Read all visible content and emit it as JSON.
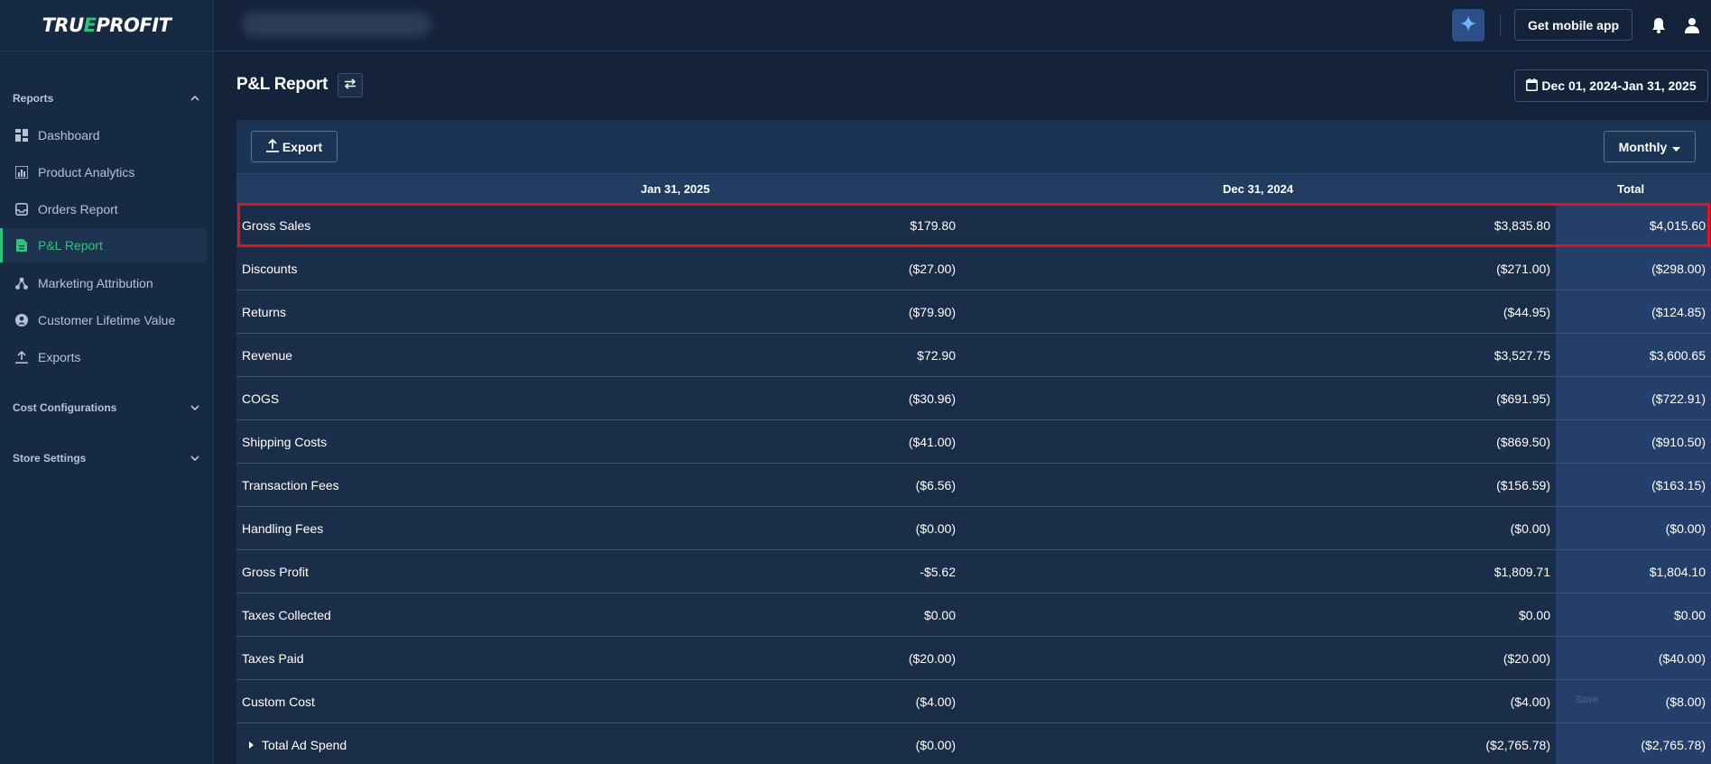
{
  "app": {
    "logo_pre": "TRU",
    "logo_mark": "E",
    "logo_post": "PROFIT"
  },
  "sidebar": {
    "reports_label": "Reports",
    "items": [
      {
        "label": "Dashboard",
        "icon": "dashboard-icon"
      },
      {
        "label": "Product Analytics",
        "icon": "bar-chart-icon"
      },
      {
        "label": "Orders Report",
        "icon": "inbox-icon"
      },
      {
        "label": "P&L Report",
        "icon": "document-icon",
        "active": true
      },
      {
        "label": "Marketing Attribution",
        "icon": "network-icon"
      },
      {
        "label": "Customer Lifetime Value",
        "icon": "user-circle-icon"
      },
      {
        "label": "Exports",
        "icon": "upload-icon"
      }
    ],
    "cost_config_label": "Cost Configurations",
    "store_settings_label": "Store Settings"
  },
  "topbar": {
    "mobile_label": "Get mobile app"
  },
  "page": {
    "title": "P&L Report",
    "date_range": "Dec 01, 2024-Jan 31, 2025"
  },
  "toolbar": {
    "export_label": "Export",
    "period_label": "Monthly"
  },
  "table": {
    "headers": [
      "Jan 31, 2025",
      "Dec 31, 2024",
      "Total"
    ],
    "rows": [
      {
        "label": "Gross Sales",
        "c1": "$179.80",
        "c2": "$3,835.80",
        "total": "$4,015.60"
      },
      {
        "label": "Discounts",
        "c1": "($27.00)",
        "c2": "($271.00)",
        "total": "($298.00)"
      },
      {
        "label": "Returns",
        "c1": "($79.90)",
        "c2": "($44.95)",
        "total": "($124.85)"
      },
      {
        "label": "Revenue",
        "c1": "$72.90",
        "c2": "$3,527.75",
        "total": "$3,600.65"
      },
      {
        "label": "COGS",
        "c1": "($30.96)",
        "c2": "($691.95)",
        "total": "($722.91)"
      },
      {
        "label": "Shipping Costs",
        "c1": "($41.00)",
        "c2": "($869.50)",
        "total": "($910.50)"
      },
      {
        "label": "Transaction Fees",
        "c1": "($6.56)",
        "c2": "($156.59)",
        "total": "($163.15)"
      },
      {
        "label": "Handling Fees",
        "c1": "($0.00)",
        "c2": "($0.00)",
        "total": "($0.00)"
      },
      {
        "label": "Gross Profit",
        "c1": "-$5.62",
        "c2": "$1,809.71",
        "total": "$1,804.10"
      },
      {
        "label": "Taxes Collected",
        "c1": "$0.00",
        "c2": "$0.00",
        "total": "$0.00"
      },
      {
        "label": "Taxes Paid",
        "c1": "($20.00)",
        "c2": "($20.00)",
        "total": "($40.00)"
      },
      {
        "label": "Custom Cost",
        "c1": "($4.00)",
        "c2": "($4.00)",
        "total": "($8.00)",
        "save_label": "Save"
      },
      {
        "label": "Total Ad Spend",
        "c1": "($0.00)",
        "c2": "($2,765.78)",
        "total": "($2,765.78)",
        "expandable": true
      }
    ]
  },
  "colors": {
    "accent": "#2fc27b",
    "highlight": "#e0141e",
    "background": "#14233a"
  }
}
